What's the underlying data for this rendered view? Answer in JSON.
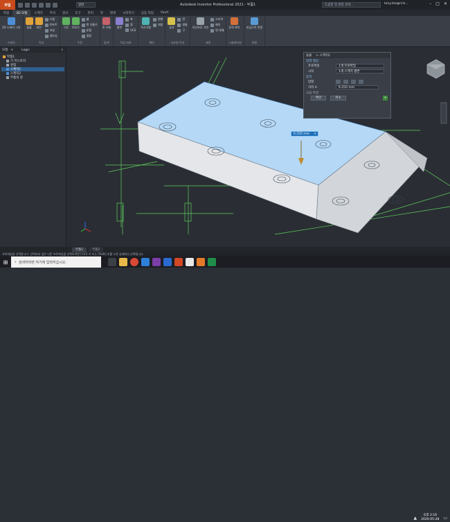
{
  "app": {
    "button_label": "파일",
    "title": "Autodesk Inventor Professional 2021 - 부품1",
    "search_placeholder": "도움말 및 명령 검색...",
    "user": "tony.lee@rick...",
    "qat_dropdown": "일반"
  },
  "tabs": [
    "파일",
    "3D 모형",
    "스케치",
    "주석",
    "검사",
    "도구",
    "관리",
    "뷰",
    "환경",
    "시작하기",
    "공동 작업",
    "Vault"
  ],
  "active_tab_index": 1,
  "ribbon": {
    "groups": [
      {
        "label": "스케치",
        "items": [
          {
            "label": "2D 스케치 시작"
          }
        ]
      },
      {
        "label": "작성",
        "items": [
          {
            "label": "돌출"
          },
          {
            "label": "회전"
          }
        ],
        "small": [
          "스윕",
          "로프트",
          "코일",
          "엠보싱"
        ]
      },
      {
        "label": "수정",
        "items": [
          {
            "label": "구멍"
          },
          {
            "label": "모깎기"
          }
        ],
        "small": [
          "쉘",
          "면 기울기",
          "분할",
          "결합"
        ]
      },
      {
        "label": "탐색",
        "items": [
          {
            "label": "면 삭제"
          }
        ]
      },
      {
        "label": "작업 피쳐",
        "items": [
          {
            "label": "평면"
          }
        ],
        "small": [
          "축",
          "점",
          "UCS"
        ]
      },
      {
        "label": "패턴",
        "items": [
          {
            "label": "직사각형"
          }
        ],
        "small": [
          "원형",
          "대칭"
        ]
      },
      {
        "label": "자유형 작성",
        "items": [
          {
            "label": "상자"
          }
        ],
        "small": [
          "면",
          "원통",
          "구"
        ]
      },
      {
        "label": "표면",
        "items": [
          {
            "label": "직선보강 곡면"
          }
        ],
        "small": [
          "스티치",
          "패치",
          "면 대체"
        ]
      },
      {
        "label": "시뮬레이션",
        "items": [
          {
            "label": "응력 해석"
          }
        ]
      },
      {
        "label": "변환",
        "items": [
          {
            "label": "판금으로 변환"
          }
        ]
      }
    ]
  },
  "browser": {
    "tabs": [
      "모형",
      "+"
    ],
    "title": "Logic",
    "nodes": [
      {
        "label": "부품1",
        "level": 0,
        "selected": false
      },
      {
        "label": "기 히스토리",
        "level": 1,
        "selected": false
      },
      {
        "label": "원점",
        "level": 1,
        "selected": false
      },
      {
        "label": "스케치1",
        "level": 1,
        "selected": true
      },
      {
        "label": "스케치2",
        "level": 1,
        "selected": false
      },
      {
        "label": "부품의 끝",
        "level": 1,
        "selected": false
      }
    ]
  },
  "panel": {
    "title": "돌출",
    "subtitle": "> 스케치2",
    "section_input": "입력 형상",
    "profile_label": "프로파일",
    "profile_value": "1개 프로파일",
    "start_label": "시작",
    "start_value": "1개 스케치 평면",
    "section_behavior": "동작",
    "direction_label": "방향",
    "distance_label": "거리 A",
    "distance_value": "6.250 mm",
    "section_output": "고급 특성",
    "ok_label": "확인",
    "cancel_label": "취소"
  },
  "dimension_input": "6.250 mm",
  "doc_tabs": [
    {
      "label": "부품1",
      "active": true
    },
    {
      "label": "부품2",
      "active": false
    }
  ],
  "status_text": "프로파일을 선택합니다. 선택되지 않은 다른 프로파일을 선택하려면 [Ctrl] 키 또는 [Shift] 키를 누른 상태에서 선택합니다.",
  "taskbar": {
    "search_placeholder": "검색하려면 여기에 입력하십시오.",
    "time": "오후 2:16",
    "date": "2020-05-28"
  },
  "colors": {
    "accent": "#c94a1a",
    "selection_fill": "#a8d2f4",
    "sketch_green": "#6fe06f"
  }
}
